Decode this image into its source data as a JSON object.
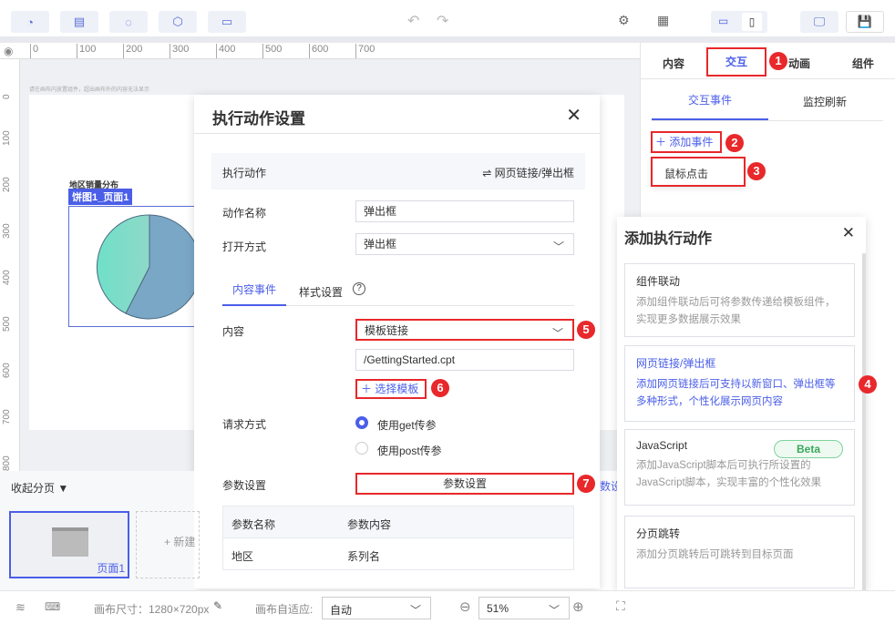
{
  "toolbar": {
    "icons": [
      "chart-icon",
      "table-icon",
      "widget-icon",
      "cube-icon",
      "archive-icon"
    ],
    "undo": "↶",
    "redo": "↷"
  },
  "canvas": {
    "hint": "请在画布内放置组件，超出画布外的内容无法显示",
    "ruler_h": [
      "0",
      "100",
      "200",
      "300",
      "400",
      "500",
      "600",
      "700"
    ],
    "ruler_v": [
      "0",
      "100",
      "200",
      "300",
      "400",
      "500",
      "600",
      "700",
      "800"
    ],
    "chart_title": "地区销量分布",
    "widget_label": "饼图1_页面1"
  },
  "dialog": {
    "title": "执行动作设置",
    "exec_label": "执行动作",
    "exec_value": "网页链接/弹出框",
    "name_label": "动作名称",
    "name_value": "弹出框",
    "open_label": "打开方式",
    "open_value": "弹出框",
    "tabs": [
      "内容事件",
      "样式设置"
    ],
    "content_label": "内容",
    "content_value": "模板链接",
    "path_value": "/GettingStarted.cpt",
    "select_template": "选择模板",
    "request_label": "请求方式",
    "radio_get": "使用get传参",
    "radio_post": "使用post传参",
    "param_label": "参数设置",
    "param_button": "参数设置",
    "table_headers": [
      "参数名称",
      "参数内容"
    ],
    "table_rows": [
      [
        "地区",
        "系列名"
      ]
    ]
  },
  "right_panel": {
    "tabs": [
      "内容",
      "交互",
      "动画",
      "组件"
    ],
    "subtabs": [
      "交互事件",
      "监控刷新"
    ],
    "add_event": "添加事件",
    "event_item": "鼠标点击",
    "overflow_text": "数设置"
  },
  "add_action": {
    "title": "添加执行动作",
    "cards": [
      {
        "title": "组件联动",
        "desc": "添加组件联动后可将参数传递给模板组件，实现更多数据展示效果"
      },
      {
        "title": "网页链接/弹出框",
        "desc": "添加网页链接后可支持以新窗口、弹出框等多种形式，个性化展示网页内容"
      },
      {
        "title": "JavaScript",
        "badge": "Beta",
        "desc": "添加JavaScript脚本后可执行所设置的JavaScript脚本，实现丰富的个性化效果"
      },
      {
        "title": "分页跳转",
        "desc": "添加分页跳转后可跳转到目标页面"
      }
    ]
  },
  "pages": {
    "collapse": "收起分页 ▼",
    "page1": "页面1",
    "new_page": "+ 新建"
  },
  "bottom": {
    "size_label": "画布尺寸：1280×720px",
    "fit_label": "画布自适应:",
    "fit_value": "自动",
    "zoom_value": "51%"
  },
  "badges": [
    "1",
    "2",
    "3",
    "4",
    "5",
    "6",
    "7"
  ],
  "colors": {
    "accent": "#4a5ee8",
    "red": "#e8282b"
  }
}
